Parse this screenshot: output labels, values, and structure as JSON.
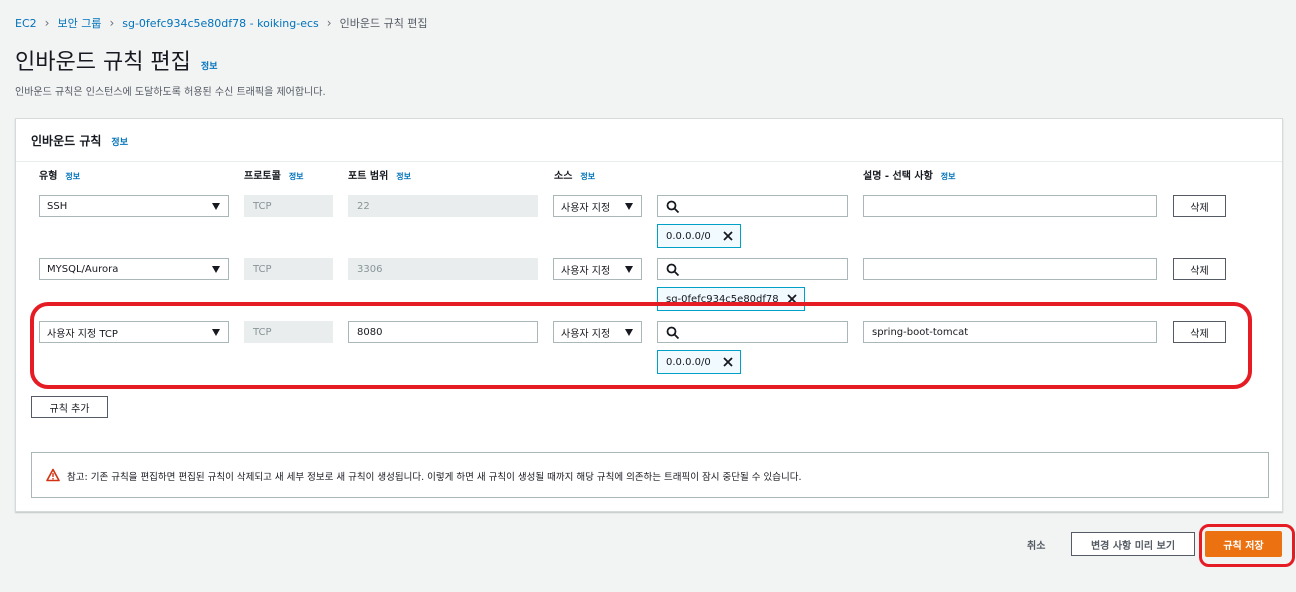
{
  "breadcrumb": {
    "items": [
      "EC2",
      "보안 그룹",
      "sg-0fefc934c5e80df78 - koiking-ecs"
    ],
    "current": "인바운드 규칙 편집"
  },
  "page": {
    "title": "인바운드 규칙 편집",
    "info_label": "정보",
    "description": "인바운드 규칙은 인스턴스에 도달하도록 허용된 수신 트래픽을 제어합니다."
  },
  "panel": {
    "title": "인바운드 규칙",
    "info_label": "정보",
    "columns": {
      "type": "유형",
      "protocol": "프로토콜",
      "port_range": "포트 범위",
      "source": "소스",
      "description": "설명 - 선택 사항",
      "info_label": "정보"
    },
    "rules": [
      {
        "type": "SSH",
        "protocol": "TCP",
        "port": "22",
        "source_type": "사용자 지정",
        "source_token": "0.0.0.0/0",
        "description": "",
        "delete_label": "삭제"
      },
      {
        "type": "MYSQL/Aurora",
        "protocol": "TCP",
        "port": "3306",
        "source_type": "사용자 지정",
        "source_token": "sg-0fefc934c5e80df78",
        "description": "",
        "delete_label": "삭제"
      },
      {
        "type": "사용자 지정 TCP",
        "protocol": "TCP",
        "port": "8080",
        "source_type": "사용자 지정",
        "source_token": "0.0.0.0/0",
        "description": "spring-boot-tomcat",
        "delete_label": "삭제"
      }
    ],
    "add_rule_label": "규칙 추가",
    "warning": "참고: 기존 규칙을 편집하면 편집된 규칙이 삭제되고 새 세부 정보로 새 규칙이 생성됩니다. 이렇게 하면 새 규칙이 생성될 때까지 해당 규칙에 의존하는 트래픽이 잠시 중단될 수 있습니다."
  },
  "footer": {
    "cancel_label": "취소",
    "preview_label": "변경 사항 미리 보기",
    "save_label": "규칙 저장"
  },
  "colors": {
    "link": "#0073bb",
    "primary_button": "#ec7211",
    "token_border": "#00a1c9",
    "annotation": "#e51c23",
    "warning_icon": "#d13212"
  }
}
